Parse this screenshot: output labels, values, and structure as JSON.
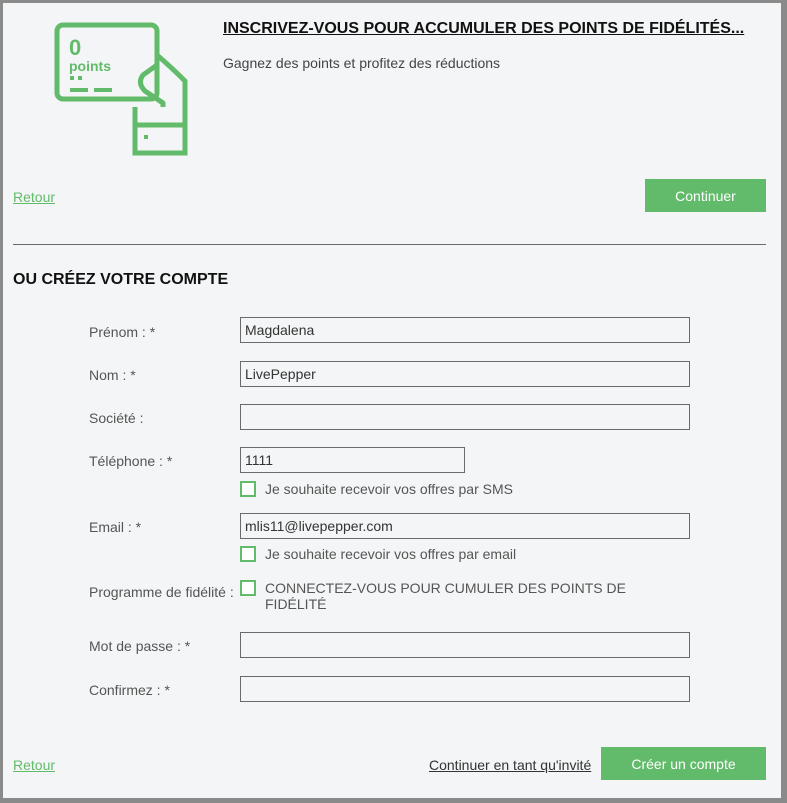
{
  "hero": {
    "points_value": "0",
    "points_unit": "points",
    "title": "INSCRIVEZ-VOUS POUR ACCUMULER DES POINTS DE FIDÉLITÉS...",
    "subtitle": "Gagnez des points et profitez des réductions",
    "icon": "loyalty-card-hand-icon"
  },
  "top_actions": {
    "back_label": "Retour",
    "continue_label": "Continuer"
  },
  "form": {
    "section_title": "OU CRÉEZ VOTRE COMPTE",
    "firstname": {
      "label": "Prénom : *",
      "value": "Magdalena"
    },
    "lastname": {
      "label": "Nom : *",
      "value": "LivePepper"
    },
    "company": {
      "label": "Société :",
      "value": ""
    },
    "phone": {
      "label": "Téléphone : *",
      "value": "1111",
      "sms_optin": "Je souhaite recevoir vos offres par SMS"
    },
    "email": {
      "label": "Email : *",
      "value": "mlis11@livepepper.com",
      "email_optin": "Je souhaite recevoir vos offres par email"
    },
    "loyalty": {
      "label": "Programme de fidélité :",
      "option": "CONNECTEZ-VOUS POUR CUMULER DES POINTS DE FIDÉLITÉ"
    },
    "password": {
      "label": "Mot de passe : *",
      "value": ""
    },
    "confirm": {
      "label": "Confirmez : *",
      "value": ""
    }
  },
  "bottom_actions": {
    "back_label": "Retour",
    "guest_label": "Continuer en tant qu'invité",
    "create_label": "Créer un compte"
  },
  "colors": {
    "accent": "#62bb6a",
    "panel_bg": "#f4f5f6",
    "frame_bg": "#8a8a8a"
  }
}
